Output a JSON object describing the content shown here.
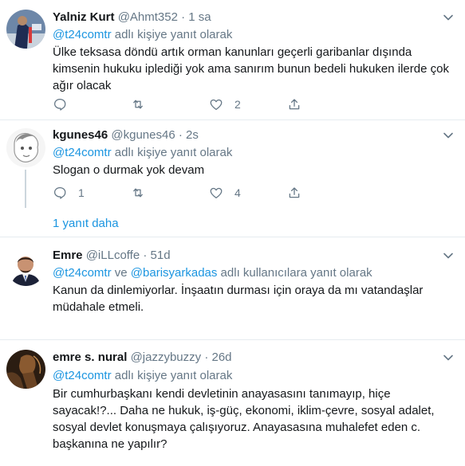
{
  "tweets": [
    {
      "name": "Yalniz Kurt",
      "handle": "@Ahmt352",
      "dot": "·",
      "time": "1 sa",
      "reply_link": "@t24comtr",
      "reply_suffix": " adlı kişiye yanıt olarak",
      "text": "Ülke teksasa döndü artık orman kanunları geçerli garibanlar dışında kimsenin hukuku iplediği yok ama sanırım bunun bedeli hukuken ilerde çok ağır olacak",
      "reply_count": "",
      "retweet_count": "",
      "like_count": "2"
    },
    {
      "name": "kgunes46",
      "handle": "@kgunes46",
      "dot": "·",
      "time": "2s",
      "reply_link": "@t24comtr",
      "reply_suffix": " adlı kişiye yanıt olarak",
      "text": "Slogan o durmak yok devam",
      "reply_count": "1",
      "retweet_count": "",
      "like_count": "4",
      "more_replies": "1 yanıt daha"
    },
    {
      "name": "Emre",
      "handle": "@iLLcoffe",
      "dot": "·",
      "time": "51d",
      "reply_link": "@t24comtr",
      "reply_mid": " ve ",
      "reply_link2": "@barisyarkadas",
      "reply_suffix": " adlı kullanıcılara yanıt olarak",
      "text": "Kanun da dinlemiyorlar.  İnşaatın durması için oraya da mı vatandaşlar müdahale etmeli."
    },
    {
      "name": "emre s. nural",
      "handle": "@jazzybuzzy",
      "dot": "·",
      "time": "26d",
      "reply_link": "@t24comtr",
      "reply_suffix": " adlı kişiye yanıt olarak",
      "text": "Bir cumhurbaşkanı kendi devletinin anayasasını tanımayıp, hiçe sayacak!?... Daha ne hukuk, iş-güç, ekonomi, iklim-çevre, sosyal adalet, sosyal devlet konuşmaya çalışıyoruz. Anayasasına muhalefet eden c. başkanına ne yapılır?"
    }
  ],
  "icons": {
    "reply": "reply-icon",
    "retweet": "retweet-icon",
    "like": "heart-icon",
    "share": "share-icon",
    "menu": "chevron-down-icon"
  },
  "colors": {
    "link": "#1b95e0",
    "muted": "#657786",
    "text": "#14171a",
    "divider": "#e6ecf0"
  }
}
